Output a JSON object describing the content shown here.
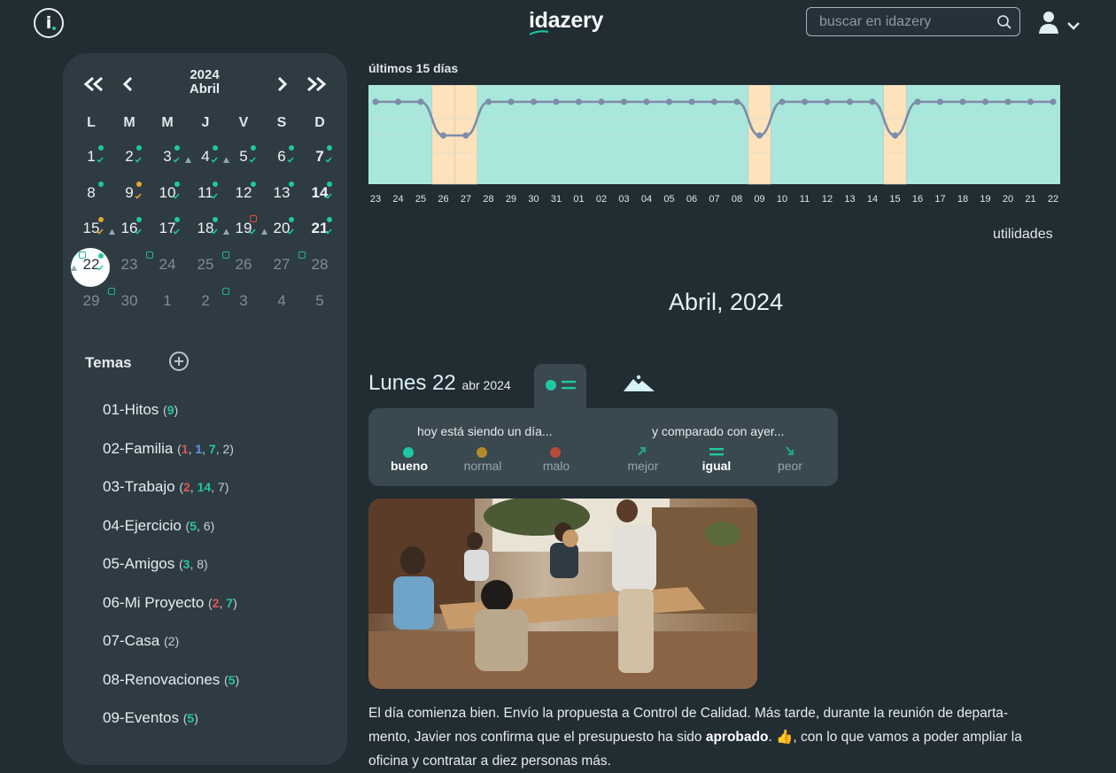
{
  "app": {
    "logo": "idazery"
  },
  "search": {
    "placeholder": "buscar en idazery"
  },
  "calendar": {
    "year": "2024",
    "month": "Abril",
    "weekdays": [
      "L",
      "M",
      "M",
      "J",
      "V",
      "S",
      "D"
    ],
    "days": [
      {
        "n": "1"
      },
      {
        "n": "2"
      },
      {
        "n": "3"
      },
      {
        "n": "4"
      },
      {
        "n": "5"
      },
      {
        "n": "6"
      },
      {
        "n": "7"
      },
      {
        "n": "8"
      },
      {
        "n": "9"
      },
      {
        "n": "10"
      },
      {
        "n": "11"
      },
      {
        "n": "12"
      },
      {
        "n": "13"
      },
      {
        "n": "14"
      },
      {
        "n": "15"
      },
      {
        "n": "16"
      },
      {
        "n": "17"
      },
      {
        "n": "18"
      },
      {
        "n": "19"
      },
      {
        "n": "20"
      },
      {
        "n": "21"
      },
      {
        "n": "22"
      },
      {
        "n": "23"
      },
      {
        "n": "24"
      },
      {
        "n": "25"
      },
      {
        "n": "26"
      },
      {
        "n": "27"
      },
      {
        "n": "28"
      },
      {
        "n": "29"
      },
      {
        "n": "30"
      },
      {
        "n": "1"
      },
      {
        "n": "2"
      },
      {
        "n": "3"
      },
      {
        "n": "4"
      },
      {
        "n": "5"
      }
    ]
  },
  "temas": {
    "heading": "Temas",
    "items": [
      {
        "label": "01-Hitos",
        "counts": [
          {
            "v": "9",
            "c": "g"
          }
        ]
      },
      {
        "label": "02-Familia",
        "counts": [
          {
            "v": "1",
            "c": "r"
          },
          {
            "v": "1",
            "c": "b"
          },
          {
            "v": "7",
            "c": "g"
          },
          {
            "v": "2",
            "c": ""
          }
        ]
      },
      {
        "label": "03-Trabajo",
        "counts": [
          {
            "v": "2",
            "c": "r"
          },
          {
            "v": "14",
            "c": "g"
          },
          {
            "v": "7",
            "c": ""
          }
        ]
      },
      {
        "label": "04-Ejercicio",
        "counts": [
          {
            "v": "5",
            "c": "g"
          },
          {
            "v": "6",
            "c": ""
          }
        ]
      },
      {
        "label": "05-Amigos",
        "counts": [
          {
            "v": "3",
            "c": "g"
          },
          {
            "v": "8",
            "c": ""
          }
        ]
      },
      {
        "label": "06-Mi Proyecto",
        "counts": [
          {
            "v": "2",
            "c": "r"
          },
          {
            "v": "7",
            "c": "g"
          }
        ]
      },
      {
        "label": "07-Casa",
        "counts": [
          {
            "v": "2",
            "c": ""
          }
        ]
      },
      {
        "label": "08-Renovaciones",
        "counts": [
          {
            "v": "5",
            "c": "g"
          }
        ]
      },
      {
        "label": "09-Eventos",
        "counts": [
          {
            "v": "5",
            "c": "g"
          }
        ]
      }
    ]
  },
  "chart_data": {
    "type": "line",
    "title": "últimos 15 días",
    "x": [
      "23",
      "24",
      "25",
      "26",
      "27",
      "28",
      "29",
      "30",
      "31",
      "01",
      "02",
      "03",
      "04",
      "05",
      "06",
      "07",
      "08",
      "09",
      "10",
      "11",
      "12",
      "13",
      "14",
      "15",
      "16",
      "17",
      "18",
      "19",
      "20",
      "21",
      "22"
    ],
    "values": [
      1,
      1,
      1,
      0,
      0,
      1,
      1,
      1,
      1,
      1,
      1,
      1,
      1,
      1,
      1,
      1,
      1,
      0,
      1,
      1,
      1,
      1,
      1,
      0,
      1,
      1,
      1,
      1,
      1,
      1,
      1
    ],
    "colors": {
      "good_bg": "#a9e7dc",
      "bad_bg": "#fde2bc",
      "line": "#7d8ca8"
    }
  },
  "main": {
    "utilities": "utilidades",
    "month_title": "Abril, 2024",
    "day_title": "Lunes 22",
    "day_sub": "abr 2024"
  },
  "mood": {
    "today_q": "hoy está siendo un día...",
    "compare_q": "y comparado con ayer...",
    "options": [
      "bueno",
      "normal",
      "malo"
    ],
    "compare": [
      "mejor",
      "igual",
      "peor"
    ],
    "selected": "bueno",
    "selected_compare": "igual"
  },
  "entry": {
    "p1": "El día comienza bien. Envío la propuesta a Control de Calidad. Más tarde, durante la reunión de departa-",
    "p2a": "mento, Javier nos confirma que el presupuesto ha sido ",
    "p2b": "aprobado",
    "p2c": ". 👍, con lo que vamos a poder ampliar la",
    "p3": "oficina y contratar a diez personas más."
  }
}
